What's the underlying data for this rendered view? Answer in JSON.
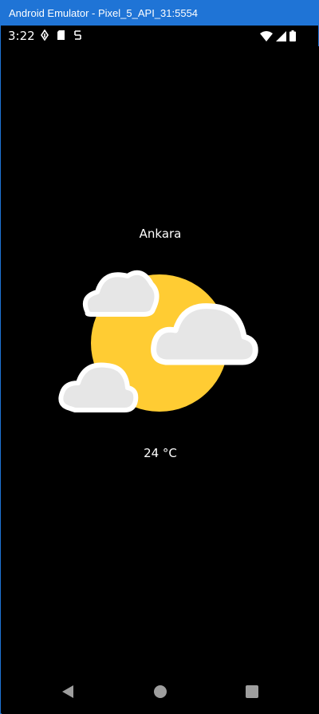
{
  "window": {
    "title": "Android Emulator - Pixel_5_API_31:5554",
    "accent": "#1f74d6"
  },
  "status_bar": {
    "time": "3:22",
    "left_icons": [
      "navigation-icon",
      "sd-card-icon",
      "sync-icon"
    ],
    "right_icons": [
      "wifi-icon",
      "signal-icon",
      "battery-icon"
    ]
  },
  "weather": {
    "city": "Ankara",
    "temperature": "24 °C",
    "condition_icon": "partly-cloudy-icon",
    "sun_color": "#ffcc33",
    "cloud_color": "#e6e6e6"
  },
  "nav_bar": {
    "buttons": [
      "back-icon",
      "home-icon",
      "recents-icon"
    ]
  }
}
